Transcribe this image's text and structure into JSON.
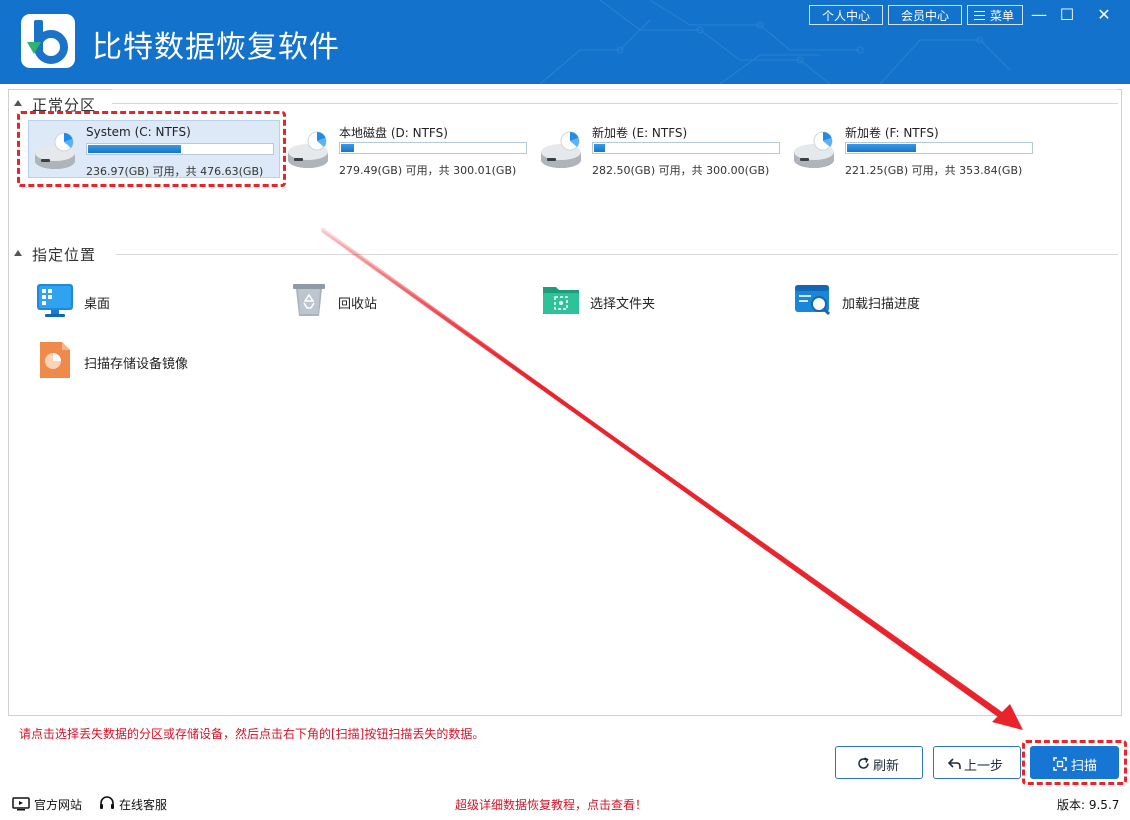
{
  "titlebar": {
    "app_title": "比特数据恢复软件",
    "personal_center": "个人中心",
    "member_center": "会员中心",
    "menu_label": "菜单",
    "minimize": "—",
    "maximize": "☐",
    "close": "✕"
  },
  "partitions": {
    "header": "正常分区",
    "drives": [
      {
        "name": "System (C: NTFS)",
        "size_text": "236.97(GB) 可用，共 476.63(GB)",
        "used_fraction": 0.503,
        "selected": true
      },
      {
        "name": "本地磁盘 (D: NTFS)",
        "size_text": "279.49(GB) 可用，共 300.01(GB)",
        "used_fraction": 0.068,
        "selected": false
      },
      {
        "name": "新加卷 (E: NTFS)",
        "size_text": "282.50(GB) 可用，共 300.00(GB)",
        "used_fraction": 0.058,
        "selected": false
      },
      {
        "name": "新加卷 (F: NTFS)",
        "size_text": "221.25(GB) 可用，共 353.84(GB)",
        "used_fraction": 0.375,
        "selected": false
      }
    ]
  },
  "locations": {
    "header": "指定位置",
    "items": [
      {
        "label": "桌面",
        "icon": "desktop-icon"
      },
      {
        "label": "回收站",
        "icon": "recycle-bin-icon"
      },
      {
        "label": "选择文件夹",
        "icon": "folder-icon"
      },
      {
        "label": "加载扫描进度",
        "icon": "load-progress-icon"
      },
      {
        "label": "扫描存储设备镜像",
        "icon": "disk-image-icon"
      }
    ]
  },
  "hint": "请点击选择丢失数据的分区或存储设备，然后点击右下角的[扫描]按钮扫描丢失的数据。",
  "buttons": {
    "refresh": "刷新",
    "back": "上一步",
    "scan": "扫描"
  },
  "footer": {
    "website": "官方网站",
    "support": "在线客服",
    "tutorial": "超级详细数据恢复教程，点击查看！",
    "version": "版本: 9.5.7"
  },
  "colors": {
    "titlebar": "#1272cc",
    "primary_button": "#1775d3",
    "annotation_red": "#e8232b",
    "hint_red": "#d0152a"
  }
}
